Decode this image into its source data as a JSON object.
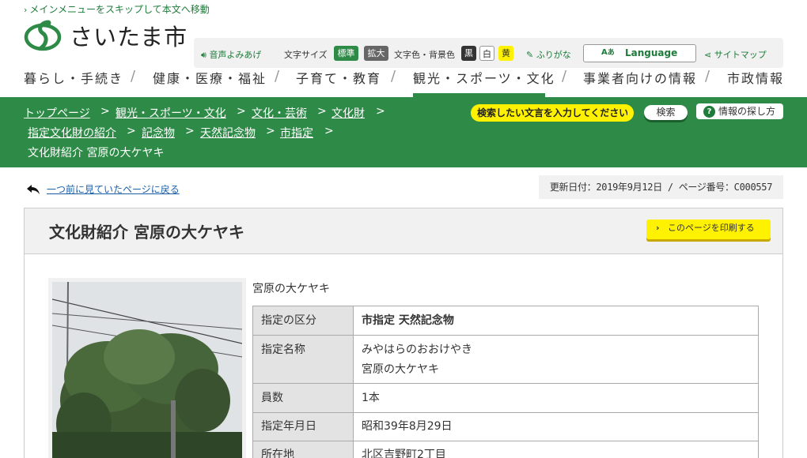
{
  "skip_link": "メインメニューをスキップして本文へ移動",
  "logo": {
    "text": "さいたま市"
  },
  "toolbar": {
    "voice": "音声よみあげ",
    "font_size_label": "文字サイズ",
    "font_standard": "標準",
    "font_large": "拡大",
    "color_label": "文字色・背景色",
    "color_black": "黒",
    "color_white": "白",
    "color_yellow": "黄",
    "furigana": "ふりがな",
    "language": "Language",
    "sitemap": "サイトマップ"
  },
  "global_nav": [
    {
      "label": "暮らし・手続き"
    },
    {
      "label": "健康・医療・福祉"
    },
    {
      "label": "子育て・教育"
    },
    {
      "label": "観光・スポーツ・文化",
      "active": true
    },
    {
      "label": "事業者向けの情報"
    },
    {
      "label": "市政情報"
    }
  ],
  "breadcrumb": {
    "items": [
      "トップページ",
      "観光・スポーツ・文化",
      "文化・芸術",
      "文化財",
      "指定文化財の紹介",
      "記念物",
      "天然記念物",
      "市指定"
    ],
    "current": "文化財紹介 宮原の大ケヤキ"
  },
  "search": {
    "placeholder": "検索したい文言を入力してください",
    "button": "検索",
    "howto": "情報の探し方"
  },
  "back_link": "一つ前に見ていたページに戻る",
  "updated": "更新日付：2019年9月12日 / ページ番号：C000557",
  "page": {
    "title": "文化財紹介 宮原の大ケヤキ",
    "print": "このページを印刷する",
    "caption": "宮原の大ケヤキ"
  },
  "info_table": [
    {
      "label": "指定の区分",
      "value": "市指定 天然記念物"
    },
    {
      "label": "指定名称",
      "value": "みやはらのおおけやき",
      "value2": "宮原の大ケヤキ"
    },
    {
      "label": "員数",
      "value": "1本"
    },
    {
      "label": "指定年月日",
      "value": "昭和39年8月29日"
    },
    {
      "label": "所在地",
      "value": "北区吉野町2丁目"
    }
  ],
  "colors": {
    "brand_green": "#2e8b47",
    "accent_yellow": "#fff200"
  }
}
